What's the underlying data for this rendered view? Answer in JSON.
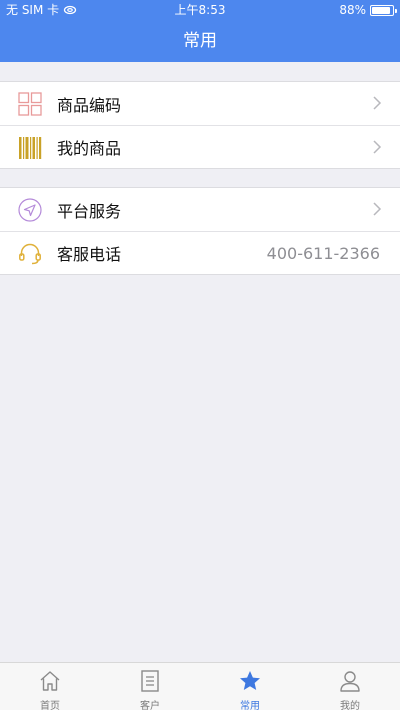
{
  "status": {
    "carrier": "无 SIM 卡",
    "time": "上午8:53",
    "battery": "88%",
    "battery_level": 0.88
  },
  "nav": {
    "title": "常用"
  },
  "group1": {
    "items": [
      {
        "label": "商品编码",
        "icon": "grid-icon"
      },
      {
        "label": "我的商品",
        "icon": "barcode-icon"
      }
    ]
  },
  "group2": {
    "items": [
      {
        "label": "平台服务",
        "icon": "send-icon"
      },
      {
        "label": "客服电话",
        "icon": "headset-icon",
        "value": "400-611-2366"
      }
    ]
  },
  "tabs": [
    {
      "label": "首页",
      "icon": "home-icon",
      "active": false
    },
    {
      "label": "客户",
      "icon": "document-icon",
      "active": false
    },
    {
      "label": "常用",
      "icon": "star-icon",
      "active": true
    },
    {
      "label": "我的",
      "icon": "person-icon",
      "active": false
    }
  ],
  "colors": {
    "primary": "#4d87ee",
    "tab_active": "#3e78e0",
    "grid_icon": "#e89a9a",
    "barcode_icon": "#c9a227",
    "send_icon": "#b48ad9",
    "headset_icon": "#e0b13a"
  }
}
